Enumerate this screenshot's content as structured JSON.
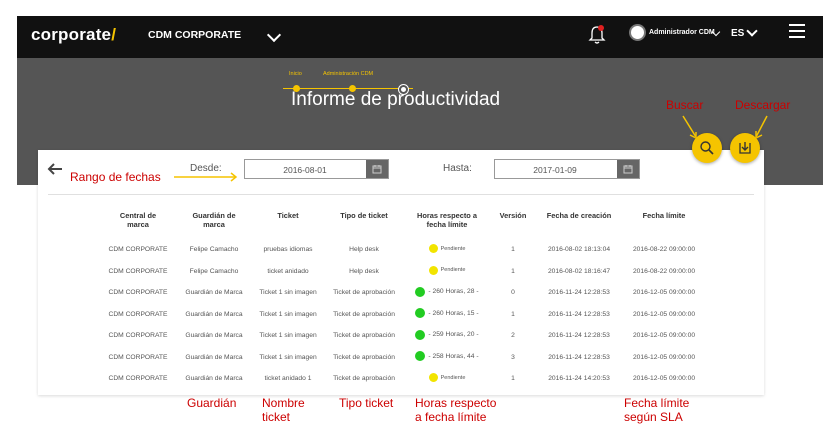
{
  "nav": {
    "logo_text": "corporate",
    "logo_slash": "/",
    "company": "CDM CORPORATE",
    "user": "Administrador CDM",
    "lang": "ES"
  },
  "header": {
    "breadcrumbs": [
      "Inicio",
      "Administración CDM"
    ],
    "title": "Informe de productividad"
  },
  "annotations": {
    "buscar": "Buscar",
    "descargar": "Descargar",
    "rango": "Rango de fechas",
    "guardian": "Guardián",
    "nombre_ticket_1": "Nombre",
    "nombre_ticket_2": "ticket",
    "tipo_ticket": "Tipo ticket",
    "horas_1": "Horas respecto",
    "horas_2": "a fecha límite",
    "fecha_1": "Fecha límite",
    "fecha_2": "según SLA"
  },
  "filters": {
    "desde_label": "Desde:",
    "desde_value": "2016-08-01",
    "hasta_label": "Hasta:",
    "hasta_value": "2017-01-09"
  },
  "table": {
    "headers": [
      [
        "Central de",
        "marca"
      ],
      [
        "Guardián de",
        "marca"
      ],
      [
        "Ticket",
        ""
      ],
      [
        "Tipo de ticket",
        ""
      ],
      [
        "Horas respecto a",
        "fecha límite"
      ],
      [
        "Versión",
        ""
      ],
      [
        "Fecha de creación",
        ""
      ],
      [
        "Fecha límite",
        ""
      ]
    ],
    "rows": [
      {
        "central": "CDM CORPORATE",
        "guardian": "Felipe Camacho",
        "ticket": "pruebas idiomas",
        "tipo": "Help desk",
        "status": "yellow",
        "horas": "Pendiente",
        "version": "1",
        "creacion": "2016-08-02 18:13:04",
        "limite": "2016-08-22 09:00:00"
      },
      {
        "central": "CDM CORPORATE",
        "guardian": "Felipe Camacho",
        "ticket": "ticket anidado",
        "tipo": "Help desk",
        "status": "yellow",
        "horas": "Pendiente",
        "version": "1",
        "creacion": "2016-08-02 18:16:47",
        "limite": "2016-08-22 09:00:00"
      },
      {
        "central": "CDM CORPORATE",
        "guardian": "Guardián de Marca",
        "ticket": "Ticket 1 sin imagen",
        "tipo": "Ticket de aprobación",
        "status": "green",
        "horas": "- 260 Horas, 28 -",
        "version": "0",
        "creacion": "2016-11-24 12:28:53",
        "limite": "2016-12-05 09:00:00"
      },
      {
        "central": "CDM CORPORATE",
        "guardian": "Guardián de Marca",
        "ticket": "Ticket 1 sin imagen",
        "tipo": "Ticket de aprobación",
        "status": "green",
        "horas": "- 260 Horas, 15 -",
        "version": "1",
        "creacion": "2016-11-24 12:28:53",
        "limite": "2016-12-05 09:00:00"
      },
      {
        "central": "CDM CORPORATE",
        "guardian": "Guardián de Marca",
        "ticket": "Ticket 1 sin imagen",
        "tipo": "Ticket de aprobación",
        "status": "green",
        "horas": "- 259 Horas, 20 -",
        "version": "2",
        "creacion": "2016-11-24 12:28:53",
        "limite": "2016-12-05 09:00:00"
      },
      {
        "central": "CDM CORPORATE",
        "guardian": "Guardián de Marca",
        "ticket": "Ticket 1 sin imagen",
        "tipo": "Ticket de aprobación",
        "status": "green",
        "horas": "- 258 Horas, 44 -",
        "version": "3",
        "creacion": "2016-11-24 12:28:53",
        "limite": "2016-12-05 09:00:00"
      },
      {
        "central": "CDM CORPORATE",
        "guardian": "Guardián de Marca",
        "ticket": "ticket anidado 1",
        "tipo": "Ticket de aprobación",
        "status": "yellow",
        "horas": "Pendiente",
        "version": "1",
        "creacion": "2016-11-24 14:20:53",
        "limite": "2016-12-05 09:00:00"
      }
    ]
  },
  "colors": {
    "accent": "#f5c400",
    "annotation": "#cc0000",
    "status_yellow": "#f2e400",
    "status_green": "#22cc22"
  },
  "icons": [
    "bell-icon",
    "user-avatar-icon",
    "chevron-down-icon",
    "menu-icon",
    "search-icon",
    "download-icon",
    "back-arrow-icon",
    "calendar-icon"
  ]
}
